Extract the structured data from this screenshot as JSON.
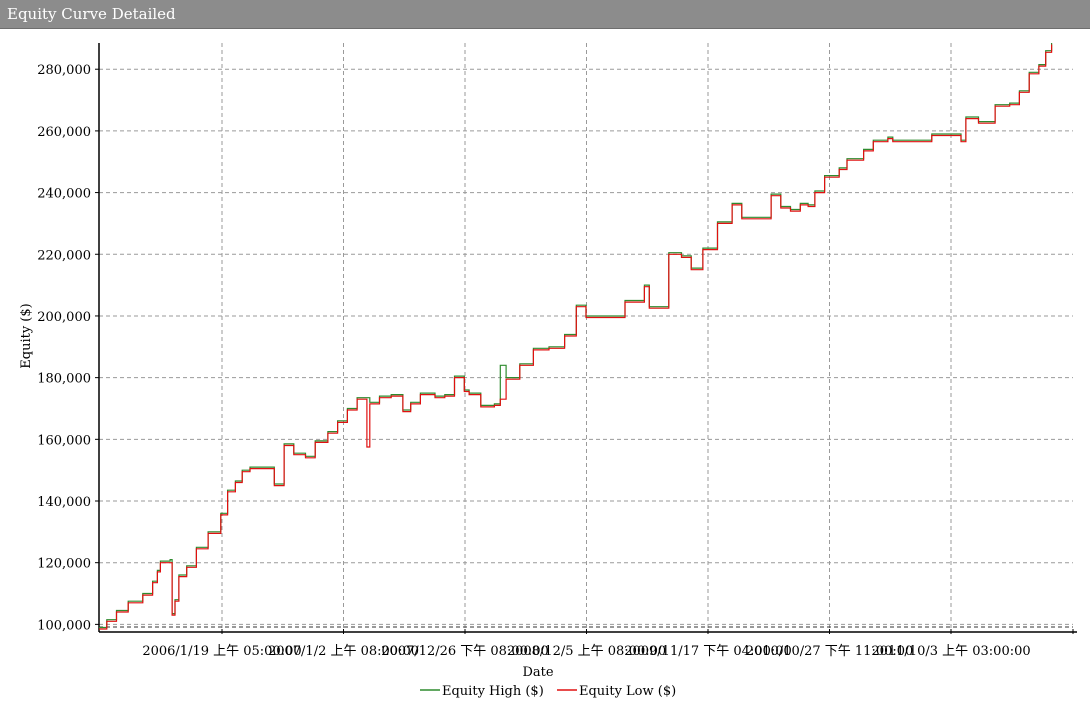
{
  "window": {
    "title": "Equity Curve Detailed"
  },
  "chart_data": {
    "type": "line",
    "title": "",
    "xlabel": "Date",
    "ylabel": "Equity ($)",
    "ylim": [
      98500,
      288500
    ],
    "x_range_index": [
      0,
      1000
    ],
    "grid": true,
    "legend_position": "bottom-center",
    "y_ticks": [
      {
        "value": 100000,
        "label": "100,000"
      },
      {
        "value": 120000,
        "label": "120,000"
      },
      {
        "value": 140000,
        "label": "140,000"
      },
      {
        "value": 160000,
        "label": "160,000"
      },
      {
        "value": 180000,
        "label": "180,000"
      },
      {
        "value": 200000,
        "label": "200,000"
      },
      {
        "value": 220000,
        "label": "220,000"
      },
      {
        "value": 240000,
        "label": "240,000"
      },
      {
        "value": 260000,
        "label": "260,000"
      },
      {
        "value": 280000,
        "label": "280,000"
      }
    ],
    "x_ticks": [
      {
        "label": "2006/1/19 上午 05:00:00"
      },
      {
        "label": "2007/1/2 上午 08:00:00"
      },
      {
        "label": "2007/12/26 下午 08:00:00"
      },
      {
        "label": "2008/12/5 上午 08:00:00"
      },
      {
        "label": "2009/11/17 下午 04:00:00"
      },
      {
        "label": "2010/10/27 下午 11:00:00"
      },
      {
        "label": "2011/10/3 上午 03:00:00"
      }
    ],
    "series_colors": {
      "high": "#2e8b2e",
      "low": "#e01010"
    },
    "series": [
      {
        "name": "Equity High ($)",
        "points": [
          [
            0,
            99000
          ],
          [
            8,
            101500
          ],
          [
            18,
            104500
          ],
          [
            30,
            107500
          ],
          [
            45,
            110000
          ],
          [
            55,
            114000
          ],
          [
            60,
            117500
          ],
          [
            63,
            120500
          ],
          [
            73,
            121000
          ],
          [
            75,
            103500
          ],
          [
            78,
            108000
          ],
          [
            82,
            116000
          ],
          [
            90,
            119000
          ],
          [
            100,
            125000
          ],
          [
            112,
            130000
          ],
          [
            125,
            136000
          ],
          [
            132,
            143500
          ],
          [
            140,
            146500
          ],
          [
            147,
            150000
          ],
          [
            155,
            151000
          ],
          [
            168,
            151000
          ],
          [
            180,
            145500
          ],
          [
            190,
            158500
          ],
          [
            200,
            155500
          ],
          [
            212,
            154500
          ],
          [
            222,
            159500
          ],
          [
            235,
            162500
          ],
          [
            245,
            166000
          ],
          [
            255,
            170000
          ],
          [
            265,
            173500
          ],
          [
            278,
            172000
          ],
          [
            288,
            174000
          ],
          [
            300,
            174500
          ],
          [
            312,
            169500
          ],
          [
            320,
            172000
          ],
          [
            330,
            175000
          ],
          [
            345,
            174000
          ],
          [
            355,
            174500
          ],
          [
            365,
            180500
          ],
          [
            375,
            176000
          ],
          [
            380,
            175000
          ],
          [
            392,
            171000
          ],
          [
            406,
            171500
          ],
          [
            412,
            184000
          ],
          [
            418,
            180000
          ],
          [
            432,
            184500
          ],
          [
            446,
            189500
          ],
          [
            462,
            190000
          ],
          [
            478,
            194000
          ],
          [
            490,
            203500
          ],
          [
            500,
            200000
          ],
          [
            517,
            200000
          ],
          [
            540,
            205000
          ],
          [
            560,
            210000
          ],
          [
            565,
            203000
          ],
          [
            585,
            220500
          ],
          [
            598,
            219500
          ],
          [
            608,
            215500
          ],
          [
            620,
            222000
          ],
          [
            635,
            230500
          ],
          [
            650,
            236500
          ],
          [
            660,
            232000
          ],
          [
            675,
            232000
          ],
          [
            690,
            239500
          ],
          [
            700,
            235500
          ],
          [
            710,
            234500
          ],
          [
            720,
            236500
          ],
          [
            728,
            236000
          ],
          [
            735,
            240500
          ],
          [
            745,
            245500
          ],
          [
            760,
            248000
          ],
          [
            768,
            251000
          ],
          [
            785,
            254000
          ],
          [
            795,
            257000
          ],
          [
            810,
            258000
          ],
          [
            815,
            257000
          ],
          [
            852,
            257000
          ],
          [
            855,
            259000
          ],
          [
            885,
            257000
          ],
          [
            890,
            264500
          ],
          [
            903,
            263000
          ],
          [
            918,
            263000
          ],
          [
            920,
            268500
          ],
          [
            935,
            269000
          ],
          [
            945,
            273000
          ],
          [
            955,
            279000
          ],
          [
            965,
            281500
          ],
          [
            972,
            286000
          ],
          [
            978,
            288500
          ]
        ]
      },
      {
        "name": "Equity Low ($)",
        "points": [
          [
            0,
            98500
          ],
          [
            8,
            101000
          ],
          [
            18,
            104000
          ],
          [
            30,
            107000
          ],
          [
            45,
            109500
          ],
          [
            55,
            113500
          ],
          [
            60,
            117000
          ],
          [
            63,
            120000
          ],
          [
            73,
            120000
          ],
          [
            75,
            103000
          ],
          [
            78,
            107500
          ],
          [
            82,
            115500
          ],
          [
            90,
            118500
          ],
          [
            100,
            124500
          ],
          [
            112,
            129500
          ],
          [
            125,
            135500
          ],
          [
            132,
            143000
          ],
          [
            140,
            146000
          ],
          [
            147,
            149500
          ],
          [
            155,
            150500
          ],
          [
            168,
            150500
          ],
          [
            180,
            145000
          ],
          [
            190,
            158000
          ],
          [
            200,
            155000
          ],
          [
            212,
            154000
          ],
          [
            222,
            159000
          ],
          [
            235,
            162000
          ],
          [
            245,
            165500
          ],
          [
            255,
            169500
          ],
          [
            265,
            173000
          ],
          [
            275,
            157500
          ],
          [
            278,
            171500
          ],
          [
            288,
            173500
          ],
          [
            300,
            174000
          ],
          [
            312,
            169000
          ],
          [
            320,
            171500
          ],
          [
            330,
            174500
          ],
          [
            345,
            173500
          ],
          [
            355,
            174000
          ],
          [
            365,
            180000
          ],
          [
            375,
            175500
          ],
          [
            380,
            174500
          ],
          [
            392,
            170500
          ],
          [
            406,
            171000
          ],
          [
            412,
            173000
          ],
          [
            418,
            179500
          ],
          [
            432,
            184000
          ],
          [
            446,
            189000
          ],
          [
            462,
            189500
          ],
          [
            478,
            193500
          ],
          [
            490,
            203000
          ],
          [
            500,
            199500
          ],
          [
            517,
            199500
          ],
          [
            540,
            204500
          ],
          [
            560,
            209500
          ],
          [
            565,
            202500
          ],
          [
            585,
            220000
          ],
          [
            598,
            219000
          ],
          [
            608,
            215000
          ],
          [
            620,
            221500
          ],
          [
            635,
            230000
          ],
          [
            650,
            236000
          ],
          [
            660,
            231500
          ],
          [
            675,
            231500
          ],
          [
            690,
            239000
          ],
          [
            700,
            235000
          ],
          [
            710,
            234000
          ],
          [
            720,
            236000
          ],
          [
            728,
            235500
          ],
          [
            735,
            240000
          ],
          [
            745,
            245000
          ],
          [
            760,
            247500
          ],
          [
            768,
            250500
          ],
          [
            785,
            253500
          ],
          [
            795,
            256500
          ],
          [
            810,
            257500
          ],
          [
            815,
            256500
          ],
          [
            852,
            256500
          ],
          [
            855,
            258500
          ],
          [
            885,
            256500
          ],
          [
            890,
            264000
          ],
          [
            903,
            262500
          ],
          [
            918,
            262500
          ],
          [
            920,
            268000
          ],
          [
            935,
            268500
          ],
          [
            945,
            272500
          ],
          [
            955,
            278500
          ],
          [
            965,
            281000
          ],
          [
            972,
            285500
          ],
          [
            978,
            288000
          ]
        ]
      }
    ]
  }
}
